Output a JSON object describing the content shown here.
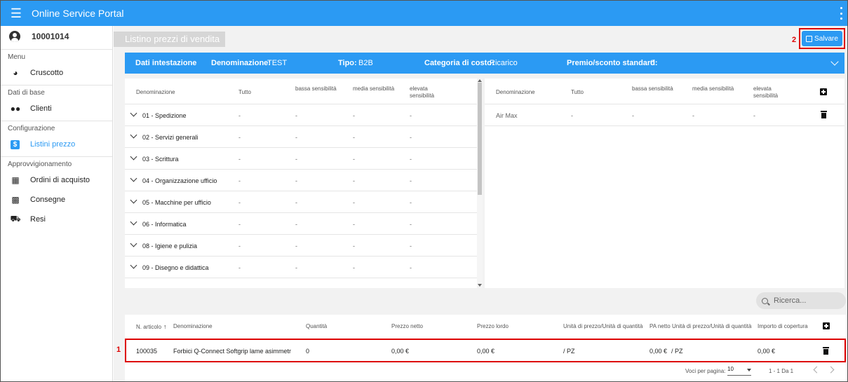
{
  "app": {
    "title": "Online Service Portal",
    "accent_color": "#2b9af3",
    "highlight_color": "#dd0000"
  },
  "sidebar": {
    "user_id": "10001014",
    "sections": [
      {
        "label": "Menu",
        "items": [
          {
            "label": "Cruscotto",
            "icon": "gauge-icon"
          }
        ]
      },
      {
        "label": "Dati di base",
        "items": [
          {
            "label": "Clienti",
            "icon": "users-icon"
          }
        ]
      },
      {
        "label": "Configurazione",
        "items": [
          {
            "label": "Listini prezzo",
            "icon": "dollar-icon",
            "active": true
          }
        ]
      },
      {
        "label": "Approvvigionamento",
        "items": [
          {
            "label": "Ordini di acquisto",
            "icon": "box-icon"
          },
          {
            "label": "Consegne",
            "icon": "delivery-check-icon"
          },
          {
            "label": "Resi",
            "icon": "truck-icon"
          }
        ]
      }
    ]
  },
  "page": {
    "title": "Listino prezzi di vendita",
    "save_label": "Salvare",
    "marker_save": "2",
    "marker_row": "1"
  },
  "header": {
    "title": "Dati intestazione",
    "denominazione_label": "Denominazione:",
    "denominazione_value": "TEST",
    "tipo_label": "Tipo:",
    "tipo_value": "B2B",
    "categoria_label": "Categoria di costo:",
    "categoria_value": "Ricarico",
    "premio_label": "Premio/sconto standard:",
    "premio_value": "0"
  },
  "left_table": {
    "columns": [
      "Denominazione",
      "Tutto",
      "bassa sensibilità",
      "media sensibilità",
      "elevata sensibilità"
    ],
    "rows": [
      {
        "name": "01 - Spedizione",
        "values": [
          "-",
          "-",
          "-",
          "-"
        ]
      },
      {
        "name": "02 - Servizi generali",
        "values": [
          "-",
          "-",
          "-",
          "-"
        ]
      },
      {
        "name": "03 - Scrittura",
        "values": [
          "-",
          "-",
          "-",
          "-"
        ]
      },
      {
        "name": "04 - Organizzazione ufficio",
        "values": [
          "-",
          "-",
          "-",
          "-"
        ]
      },
      {
        "name": "05 - Macchine per ufficio",
        "values": [
          "-",
          "-",
          "-",
          "-"
        ]
      },
      {
        "name": "06 - Informatica",
        "values": [
          "-",
          "-",
          "-",
          "-"
        ]
      },
      {
        "name": "08 - Igiene e pulizia",
        "values": [
          "-",
          "-",
          "-",
          "-"
        ]
      },
      {
        "name": "09 - Disegno e didattica",
        "values": [
          "-",
          "-",
          "-",
          "-"
        ]
      }
    ]
  },
  "right_table": {
    "columns": [
      "Denominazione",
      "Tutto",
      "bassa sensibilità",
      "media sensibilità",
      "elevata sensibilità"
    ],
    "rows": [
      {
        "name": "Air Max",
        "values": [
          "-",
          "-",
          "-",
          "-"
        ]
      }
    ]
  },
  "search": {
    "placeholder": "Ricerca..."
  },
  "articles_table": {
    "columns": [
      "N. articolo",
      "Denominazione",
      "Quantità",
      "Prezzo netto",
      "Prezzo lordo",
      "Unità di prezzo/Unità di quantità",
      "PA netto",
      "Unità di prezzo/Unità di quantità",
      "Importo di copertura"
    ],
    "rows": [
      {
        "article": "100035",
        "name": "Forbici Q-Connect Softgrip lame asimmetr",
        "qty": "0",
        "net": "0,00 €",
        "gross": "0,00 €",
        "unit": "/ PZ",
        "pa_net": "0,00 €",
        "unit2": "/ PZ",
        "coverage": "0,00 €"
      }
    ],
    "footer": {
      "per_page_label": "Voci per pagina:",
      "per_page_value": "10",
      "range": "1 - 1 Da 1"
    }
  }
}
